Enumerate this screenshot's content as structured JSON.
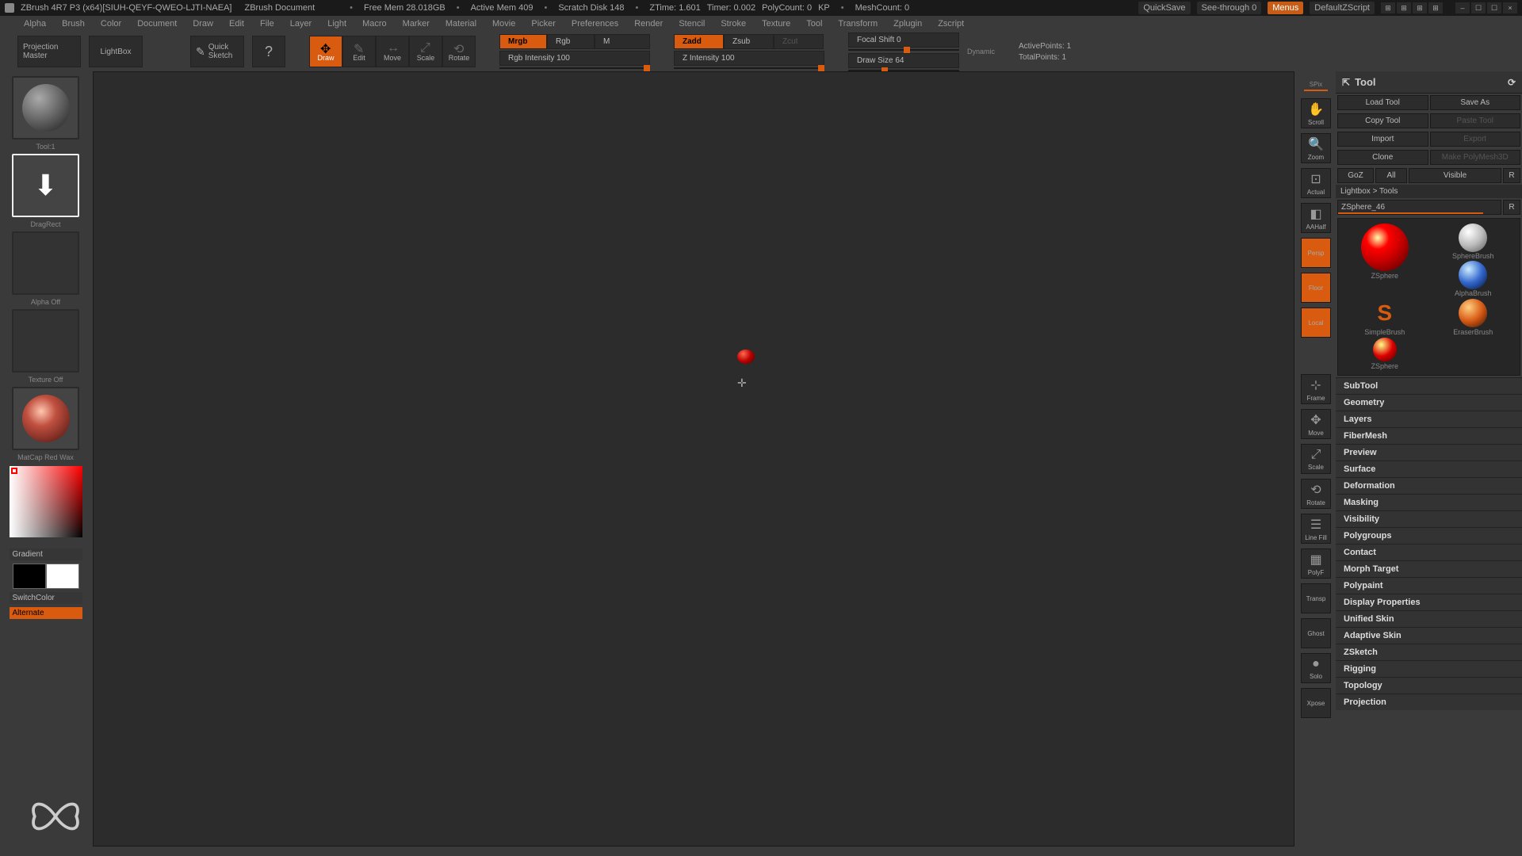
{
  "titlebar": {
    "app": "ZBrush 4R7 P3 (x64)[SIUH-QEYF-QWEO-LJTI-NAEA]",
    "doc": "ZBrush Document",
    "free_mem": "Free Mem 28.018GB",
    "active_mem": "Active Mem 409",
    "scratch": "Scratch Disk 148",
    "ztime": "ZTime: 1.601",
    "timer": "Timer: 0.002",
    "polycount": "PolyCount: 0",
    "kp": "KP",
    "meshcount": "MeshCount: 0",
    "quicksave": "QuickSave",
    "seethrough": "See-through   0",
    "menus": "Menus",
    "defaultzscript": "DefaultZScript"
  },
  "menubar": [
    "Alpha",
    "Brush",
    "Color",
    "Document",
    "Draw",
    "Edit",
    "File",
    "Layer",
    "Light",
    "Macro",
    "Marker",
    "Material",
    "Movie",
    "Picker",
    "Preferences",
    "Render",
    "Stencil",
    "Stroke",
    "Texture",
    "Tool",
    "Transform",
    "Zplugin",
    "Zscript"
  ],
  "toolbar": {
    "projection_master": "Projection Master",
    "lightbox": "LightBox",
    "quick_sketch": "Quick Sketch",
    "modes": [
      "Draw",
      "Edit",
      "Move",
      "Scale",
      "Rotate"
    ],
    "mrgb_tabs": [
      "Mrgb",
      "Rgb",
      "M"
    ],
    "rgb_intensity": "Rgb Intensity 100",
    "zadd_tabs": [
      "Zadd",
      "Zsub",
      "Zcut"
    ],
    "z_intensity": "Z Intensity 100",
    "focal_shift": "Focal Shift 0",
    "draw_size": "Draw Size 64",
    "dynamic": "Dynamic",
    "active_points": "ActivePoints: 1",
    "total_points": "TotalPoints: 1"
  },
  "left": {
    "tool_prev": "Tool:1",
    "stroke": "DragRect",
    "alpha": "Alpha Off",
    "texture": "Texture Off",
    "material": "MatCap Red Wax",
    "gradient": "Gradient",
    "switchcolor": "SwitchColor",
    "alternate": "Alternate"
  },
  "rightstrip": [
    "SPix",
    "Scroll",
    "Zoom",
    "Actual",
    "AAHalf",
    "Persp",
    "Floor",
    "Local",
    "",
    "",
    "Frame",
    "Move",
    "Scale",
    "Rotate",
    "Line Fill",
    "PolyF",
    "Transp",
    "Ghost",
    "Solo",
    "Xpose",
    "",
    ""
  ],
  "tool": {
    "header": "Tool",
    "load": "Load Tool",
    "saveas": "Save As",
    "copy": "Copy Tool",
    "paste": "Paste Tool",
    "import": "Import",
    "export": "Export",
    "clone": "Clone",
    "polymesh": "Make PolyMesh3D",
    "goz": "GoZ",
    "all": "All",
    "visible": "Visible",
    "r1": "R",
    "lb_tools": "Lightbox > Tools",
    "current": "ZSphere_46",
    "r2": "R",
    "grid": {
      "zsphere": "ZSphere",
      "spherebrush": "SphereBrush",
      "alphabrush": "AlphaBrush",
      "simplebrush": "SimpleBrush",
      "eraserbrush": "EraserBrush",
      "zsphere2": "ZSphere"
    },
    "sections": [
      "SubTool",
      "Geometry",
      "Layers",
      "FiberMesh",
      "Preview",
      "Surface",
      "Deformation",
      "Masking",
      "Visibility",
      "Polygroups",
      "Contact",
      "Morph Target",
      "Polypaint",
      "Display Properties",
      "Unified Skin",
      "Adaptive Skin",
      "ZSketch",
      "Rigging",
      "Topology",
      "Projection"
    ]
  }
}
